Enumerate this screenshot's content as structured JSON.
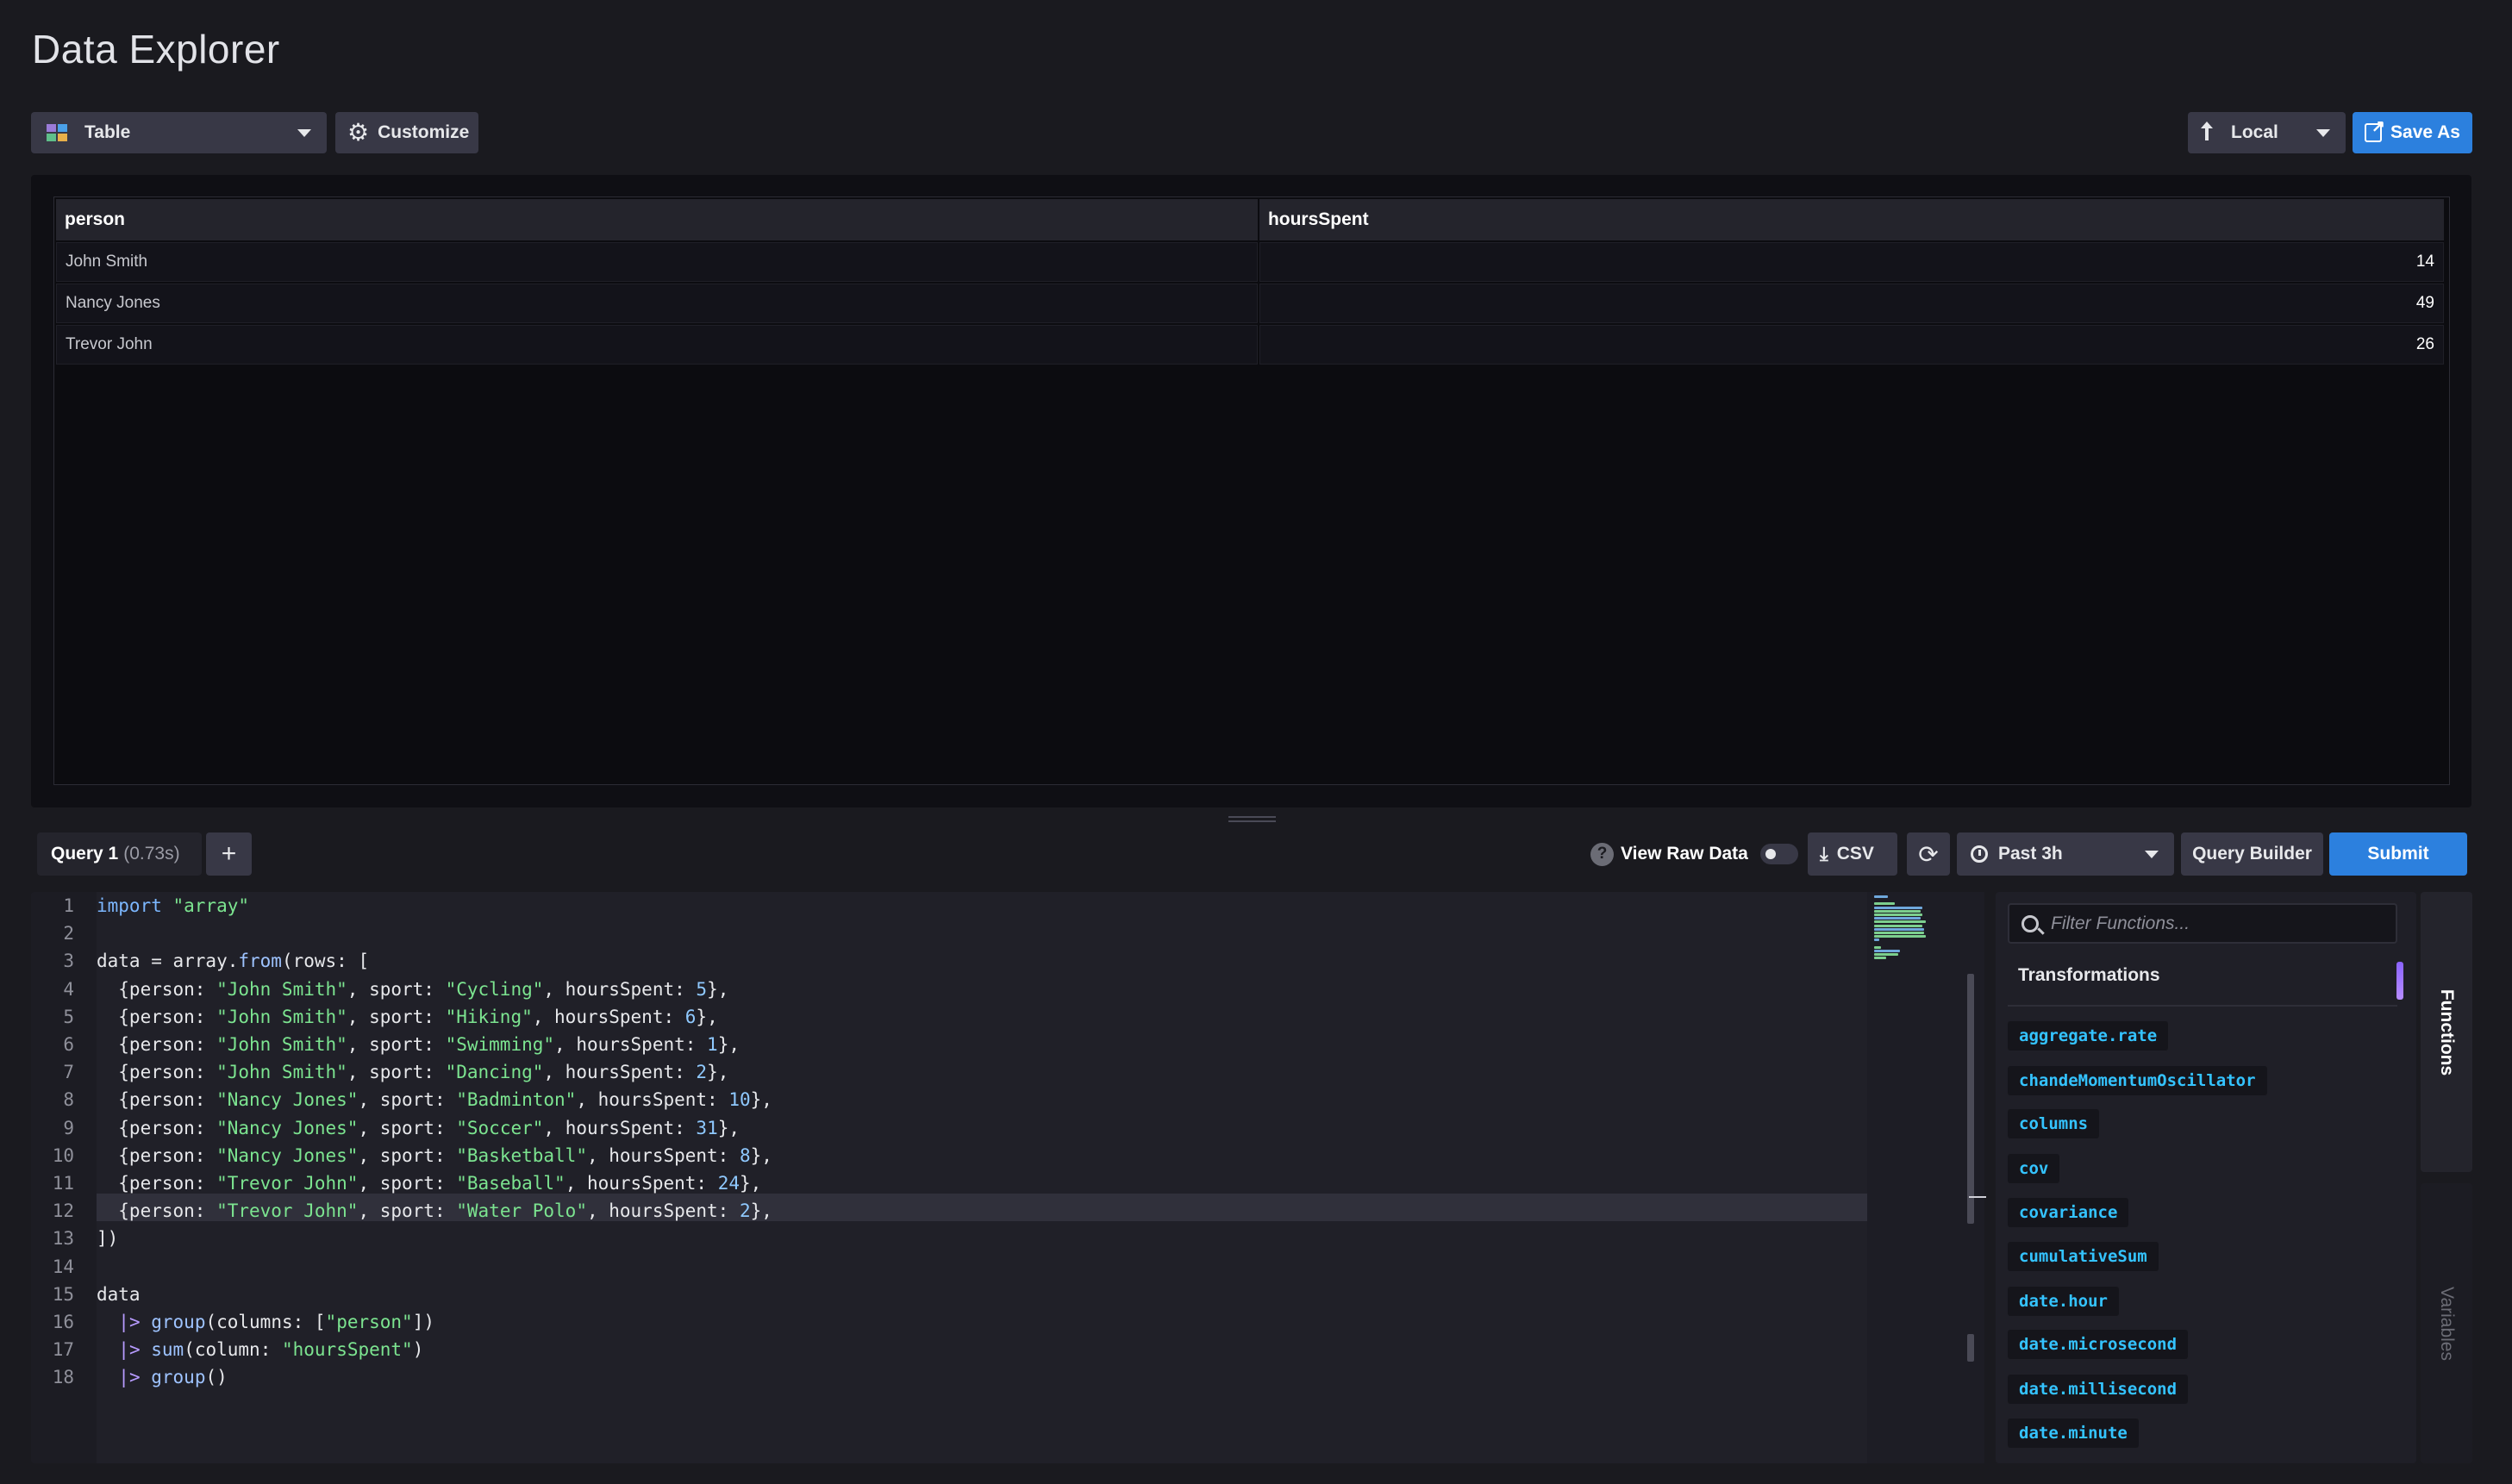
{
  "page": {
    "title": "Data Explorer"
  },
  "toolbar": {
    "viz_type": "Table",
    "customize_label": "Customize",
    "local_label": "Local",
    "save_as_label": "Save As"
  },
  "result_table": {
    "columns": [
      "person",
      "hoursSpent"
    ],
    "rows": [
      [
        "John Smith",
        "14"
      ],
      [
        "Nancy Jones",
        "49"
      ],
      [
        "Trevor John",
        "26"
      ]
    ]
  },
  "query_bar": {
    "tab_name": "Query 1",
    "tab_time": "(0.73s)",
    "add_label": "+",
    "raw_data_label": "View Raw Data",
    "csv_label": "CSV",
    "time_range": "Past 3h",
    "query_builder_label": "Query Builder",
    "submit_label": "Submit"
  },
  "editor": {
    "line_numbers": [
      "1",
      "2",
      "3",
      "4",
      "5",
      "6",
      "7",
      "8",
      "9",
      "10",
      "11",
      "12",
      "13",
      "14",
      "15",
      "16",
      "17",
      "18"
    ],
    "lines": [
      "import \"array\"",
      "",
      "data = array.from(rows: [",
      "  {person: \"John Smith\", sport: \"Cycling\", hoursSpent: 5},",
      "  {person: \"John Smith\", sport: \"Hiking\", hoursSpent: 6},",
      "  {person: \"John Smith\", sport: \"Swimming\", hoursSpent: 1},",
      "  {person: \"John Smith\", sport: \"Dancing\", hoursSpent: 2},",
      "  {person: \"Nancy Jones\", sport: \"Badminton\", hoursSpent: 10},",
      "  {person: \"Nancy Jones\", sport: \"Soccer\", hoursSpent: 31},",
      "  {person: \"Nancy Jones\", sport: \"Basketball\", hoursSpent: 8},",
      "  {person: \"Trevor John\", sport: \"Baseball\", hoursSpent: 24},",
      "  {person: \"Trevor John\", sport: \"Water Polo\", hoursSpent: 2},",
      "])",
      "",
      "data",
      "  |> group(columns: [\"person\"])",
      "  |> sum(column: \"hoursSpent\")",
      "  |> group()"
    ]
  },
  "functions_panel": {
    "search_placeholder": "Filter Functions...",
    "heading": "Transformations",
    "items": [
      "aggregate.rate",
      "chandeMomentumOscillator",
      "columns",
      "cov",
      "covariance",
      "cumulativeSum",
      "date.hour",
      "date.microsecond",
      "date.millisecond",
      "date.minute"
    ]
  },
  "side_tabs": {
    "functions": "Functions",
    "variables": "Variables"
  },
  "colors": {
    "accent": "#2c80de",
    "function_item": "#34c3ff",
    "background": "#1a1a1f"
  }
}
